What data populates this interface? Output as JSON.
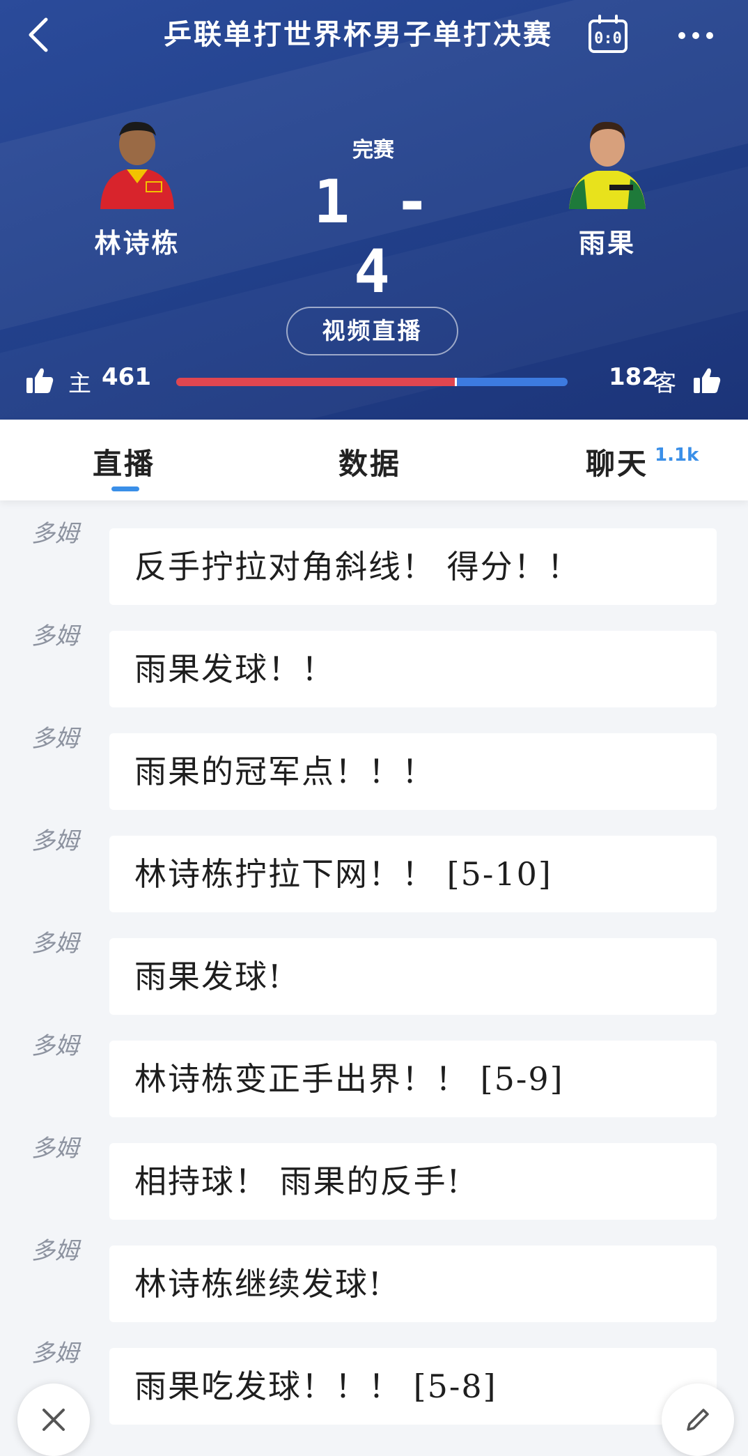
{
  "header": {
    "title": "乒联单打世界杯男子单打决赛",
    "status": "完赛",
    "score": "1 - 4",
    "home_player": {
      "name": "林诗栋"
    },
    "away_player": {
      "name": "雨果"
    },
    "live_button": "视频直播",
    "votes": {
      "home_label": "主",
      "home_count": "461",
      "away_count": "182",
      "away_label": "客",
      "home_share": 0.717,
      "home_color": "#e04650",
      "away_color": "#3d7be0"
    },
    "icons": {
      "back": "chevron-left-icon",
      "scoreboard": "scoreboard-icon",
      "more": "more-dots-icon",
      "thumb": "thumbs-up-icon"
    }
  },
  "tabs": [
    {
      "label": "直播",
      "active": true
    },
    {
      "label": "数据",
      "active": false
    },
    {
      "label": "聊天",
      "active": false,
      "badge": "1.1k"
    }
  ],
  "accent_color": "#3a8fe8",
  "feed": [
    {
      "author": "多姆",
      "text": "反手拧拉对角斜线！ 得分！！"
    },
    {
      "author": "多姆",
      "text": "雨果发球！！"
    },
    {
      "author": "多姆",
      "text": "雨果的冠军点！！！"
    },
    {
      "author": "多姆",
      "text": "林诗栋拧拉下网！！ [5-10]"
    },
    {
      "author": "多姆",
      "text": "雨果发球!"
    },
    {
      "author": "多姆",
      "text": "林诗栋变正手出界！！ [5-9]"
    },
    {
      "author": "多姆",
      "text": "相持球！ 雨果的反手!"
    },
    {
      "author": "多姆",
      "text": "林诗栋继续发球!"
    },
    {
      "author": "多姆",
      "text": "雨果吃发球！！！ [5-8]"
    }
  ]
}
